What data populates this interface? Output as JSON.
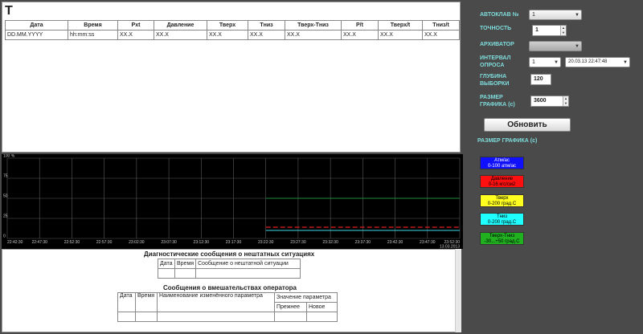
{
  "top": {
    "title": "T",
    "columns": [
      "Дата",
      "Время",
      "Pxt",
      "Давление",
      "Тверх",
      "Тниз",
      "Тверх-Тниз",
      "P/t",
      "Тверх/t",
      "Тниз/t"
    ],
    "row": [
      "DD.MM.YYYY",
      "hh:mm:ss",
      "XX.X",
      "XX.X",
      "XX.X",
      "XX.X",
      "XX.X",
      "XX.X",
      "XX.X",
      "XX.X"
    ]
  },
  "chart_data": {
    "type": "line",
    "y_ticks": [
      "100 %",
      "75",
      "50",
      "25",
      "0"
    ],
    "x_ticks": [
      "22:42:30",
      "22:47:30",
      "22:52:30",
      "22:57:30",
      "23:02:30",
      "23:07:30",
      "23:12:30",
      "23:17:30",
      "23:22:30",
      "23:27:30",
      "23:32:30",
      "23:37:30",
      "23:42:30",
      "23:47:30",
      "23:52:30"
    ],
    "end_label": "13.03.2013",
    "ylim": [
      0,
      100
    ],
    "series": [
      {
        "color": "#1e8a3c",
        "values": [
          null,
          null,
          null,
          null,
          null,
          null,
          null,
          null,
          50,
          50,
          50,
          50,
          50,
          50,
          50
        ]
      },
      {
        "color": "#e02020",
        "values": [
          null,
          null,
          null,
          null,
          null,
          null,
          null,
          null,
          14,
          14,
          14,
          14,
          14,
          14,
          14
        ]
      },
      {
        "color": "#40d8e8",
        "values": [
          null,
          null,
          null,
          null,
          null,
          null,
          null,
          null,
          10,
          10,
          10,
          10,
          10,
          10,
          10
        ]
      }
    ]
  },
  "diagnostics": {
    "title": "Диагностические сообщения о нештатных ситуациях",
    "columns": [
      "Дата",
      "Время",
      "Сообщение о нештатной ситуации"
    ]
  },
  "operator": {
    "title": "Сообщения о вмешательствах оператора",
    "columns": [
      "Дата",
      "Время",
      "Наименование изменённого параметра",
      "Значение параметра"
    ],
    "subcolumns": [
      "Прежнее",
      "Новое"
    ]
  },
  "controls": {
    "autoclave_label": "АВТОКЛАВ №",
    "autoclave_value": "1",
    "precision_label": "ТОЧНОСТЬ",
    "precision_value": "1",
    "archiver_label": "АРХИВАТОР",
    "archiver_value": "",
    "interval_label_1": "ИНТЕРВАЛ",
    "interval_label_2": "ОПРОСА",
    "interval_value": "1",
    "datetime_value": "20.03.13 22:47:48",
    "depth_label_1": "ГЛУБИНА",
    "depth_label_2": "ВЫБОРКИ",
    "depth_value": "120",
    "graph_size_label_1": "РАЗМЕР",
    "graph_size_label_2": "ГРАФИКА (с)",
    "graph_size_value": "3600",
    "refresh_label": "Обновить",
    "graph_size_caption": "РАЗМЕР ГРАФИКА (с)"
  },
  "legend": [
    {
      "line1": "Атм/ас",
      "line2": "0-100 атм/ас",
      "color": "#1010ff",
      "text_color": "#ffffff"
    },
    {
      "line1": "Давление",
      "line2": "0-16 кгс/см2",
      "color": "#ff1010",
      "text_color": "#000000"
    },
    {
      "line1": "Тверх",
      "line2": "0-200 град.С",
      "color": "#ffff20",
      "text_color": "#000000"
    },
    {
      "line1": "Тниз",
      "line2": "0-200 град.С",
      "color": "#20ffff",
      "text_color": "#000000"
    },
    {
      "line1": "Тверх-Тниз",
      "line2": "-30...+50 град.С",
      "color": "#20b020",
      "text_color": "#000000"
    }
  ]
}
